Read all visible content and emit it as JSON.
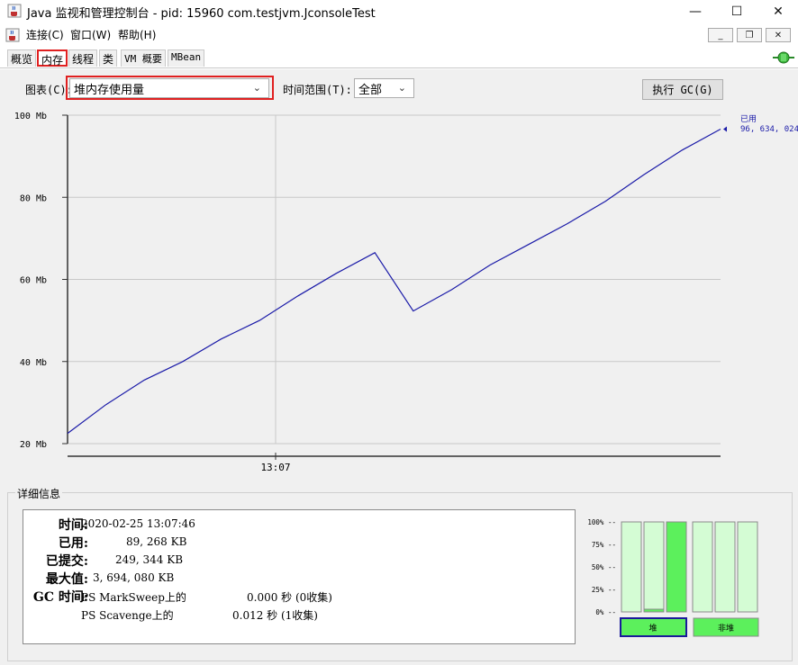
{
  "window": {
    "title": "Java 监视和管理控制台 - pid: 15960 com.testjvm.JconsoleTest",
    "minimize_glyph": "—",
    "maximize_glyph": "☐",
    "close_glyph": "✕",
    "icon": "java-cup-icon"
  },
  "menubar": {
    "items": [
      "连接(C)",
      "窗口(W)",
      "帮助(H)"
    ],
    "mdi_minimize": "_",
    "mdi_restore": "❐",
    "mdi_close": "✕"
  },
  "tabs": [
    {
      "label": "概览"
    },
    {
      "label": "内存",
      "active": true
    },
    {
      "label": "线程"
    },
    {
      "label": "类"
    },
    {
      "label": "VM 概要"
    },
    {
      "label": "MBean"
    }
  ],
  "controls": {
    "chart_label": "图表(C):",
    "chart_value": "堆内存使用量",
    "range_label": "时间范围(T):",
    "range_value": "全部",
    "gc_button": "执行 GC(G)"
  },
  "chart_data": {
    "type": "line",
    "y_tick_labels": [
      "100 Mb",
      "80 Mb",
      "60 Mb",
      "40 Mb",
      "20 Mb"
    ],
    "ylim": [
      20,
      100
    ],
    "x_tick_label": "13:07",
    "series": [
      {
        "name": "已用",
        "color": "#1a1aa8",
        "values": [
          22.5,
          29.5,
          35.5,
          40,
          45.5,
          50,
          56,
          61.5,
          66.5,
          52.3,
          57.5,
          63.5,
          68.5,
          73.5,
          79,
          85.5,
          91.5,
          96.6
        ]
      }
    ],
    "legend_label": "已用",
    "legend_value": "96, 634, 024",
    "grid": true
  },
  "details": {
    "title": "详细信息",
    "rows": [
      {
        "key": "时间:",
        "value": "2020-02-25 13:07:46"
      },
      {
        "key": "已用:",
        "value": "89, 268 KB"
      },
      {
        "key": "已提交:",
        "value": "249, 344 KB"
      },
      {
        "key": "最大值:",
        "value": "3, 694, 080 KB"
      },
      {
        "key": "GC 时间:",
        "value": "PS MarkSweep上的"
      }
    ],
    "gc_rows": [
      {
        "collector": "PS MarkSweep上的",
        "time": "0.000 秒 (0收集)"
      },
      {
        "collector": "PS Scavenge上的",
        "time": "0.012 秒 (1收集)"
      }
    ]
  },
  "usage_bars": {
    "ticks": [
      "100% --",
      "75% --",
      "50% --",
      "25% --",
      "0% --"
    ],
    "heap_pools": [
      0.0,
      0.03,
      1.0
    ],
    "nonheap_pools": [
      0.0,
      0.0,
      0.0
    ],
    "heap_button": "堆",
    "nonheap_button": "非堆",
    "fill_color": "#5cf05c",
    "empty_color": "#d4fcd4"
  }
}
